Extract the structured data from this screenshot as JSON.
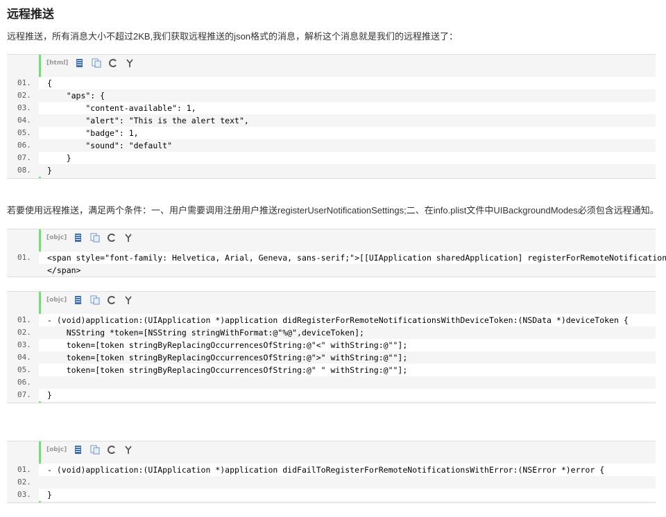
{
  "title": "远程推送",
  "intro": "远程推送，所有消息大小不超过2KB,我们获取远程推送的json格式的消息，解析这个消息就是我们的远程推送了：",
  "condition_text": "若要使用远程推送，满足两个条件：一、用户需要调用注册用户推送registerUserNotificationSettings;二、在info.plist文件中UIBackgroundModes必须包含远程通知。",
  "blocks": [
    {
      "lang": "[html]",
      "lines": [
        {
          "n": "01.",
          "t": "{"
        },
        {
          "n": "02.",
          "t": "    \"aps\": {"
        },
        {
          "n": "03.",
          "t": "        \"content-available\": 1,"
        },
        {
          "n": "04.",
          "t": "        \"alert\": \"This is the alert text\","
        },
        {
          "n": "05.",
          "t": "        \"badge\": 1,"
        },
        {
          "n": "06.",
          "t": "        \"sound\": \"default\""
        },
        {
          "n": "07.",
          "t": "    }"
        },
        {
          "n": "08.",
          "t": "}"
        }
      ]
    },
    {
      "lang": "[objc]",
      "lines": [
        {
          "n": "01.",
          "t": "<span style=\"font-family: Helvetica, Arial, Geneva, sans-serif;\">[[UIApplication sharedApplication] registerForRemoteNotifications];"
        },
        {
          "n": "",
          "t": "</span>"
        }
      ]
    },
    {
      "lang": "[objc]",
      "lines": [
        {
          "n": "01.",
          "t": "- (void)application:(UIApplication *)application didRegisterForRemoteNotificationsWithDeviceToken:(NSData *)deviceToken {"
        },
        {
          "n": "02.",
          "t": "    NSString *token=[NSString stringWithFormat:@\"%@\",deviceToken];"
        },
        {
          "n": "03.",
          "t": "    token=[token stringByReplacingOccurrencesOfString:@\"<\" withString:@\"\"];"
        },
        {
          "n": "04.",
          "t": "    token=[token stringByReplacingOccurrencesOfString:@\">\" withString:@\"\"];"
        },
        {
          "n": "05.",
          "t": "    token=[token stringByReplacingOccurrencesOfString:@\" \" withString:@\"\"];"
        },
        {
          "n": "06.",
          "t": ""
        },
        {
          "n": "07.",
          "t": "}"
        }
      ]
    },
    {
      "lang": "[objc]",
      "lines": [
        {
          "n": "01.",
          "t": "- (void)application:(UIApplication *)application didFailToRegisterForRemoteNotificationsWithError:(NSError *)error {"
        },
        {
          "n": "02.",
          "t": ""
        },
        {
          "n": "03.",
          "t": "}"
        }
      ]
    }
  ],
  "toolbar_icons": [
    "view-source-icon",
    "copy-icon",
    "print-icon",
    "help-icon"
  ]
}
